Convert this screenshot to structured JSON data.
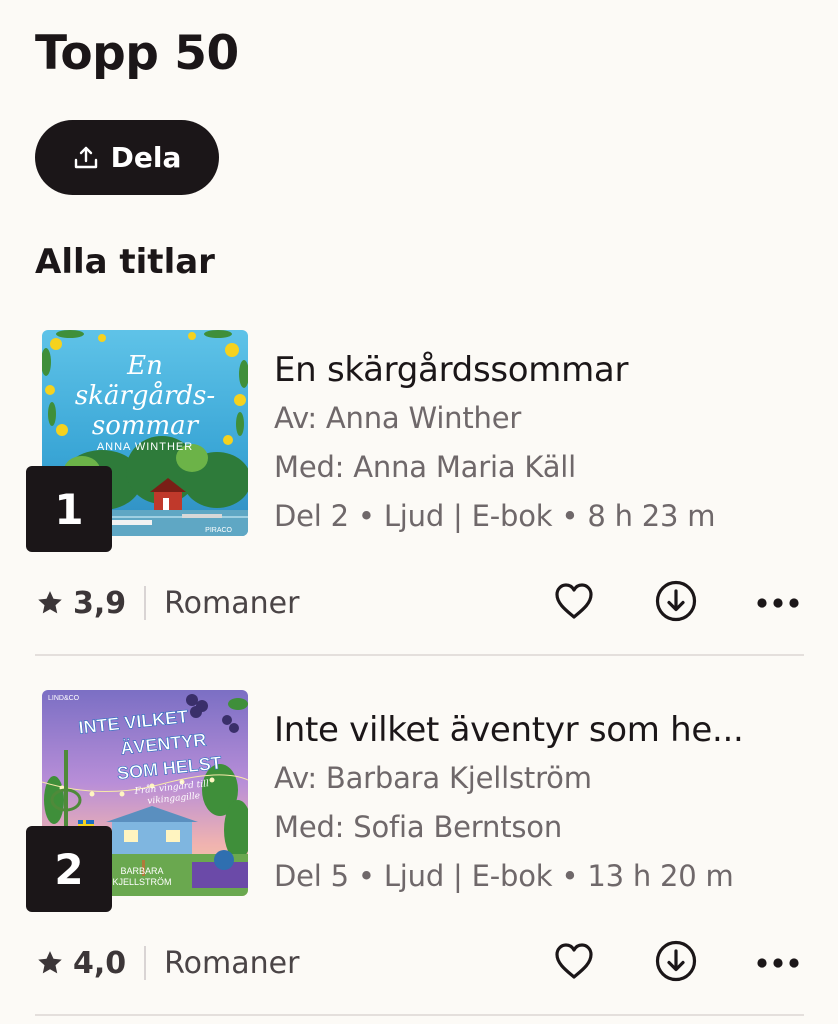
{
  "header": {
    "title": "Topp 50",
    "share_label": "Dela",
    "share_icon": "share-upload-icon"
  },
  "section": {
    "title": "Alla titlar"
  },
  "books": [
    {
      "rank": "1",
      "title": "En skärgårdssommar",
      "author": "Av: Anna Winther",
      "narrator": "Med: Anna Maria Käll",
      "details": "Del 2 • Ljud | E-bok • 8 h 23 m",
      "rating": "3,9",
      "genre": "Romaner",
      "cover": {
        "title_lines": [
          "En",
          "skärgårds-",
          "sommar"
        ],
        "author": "ANNA WINTHER",
        "publisher": "PIRACO"
      }
    },
    {
      "rank": "2",
      "title": "Inte vilket äventyr som he...",
      "author": "Av: Barbara Kjellström",
      "narrator": "Med: Sofia Berntson",
      "details": "Del 5 • Ljud | E-bok • 13 h 20 m",
      "rating": "4,0",
      "genre": "Romaner",
      "cover": {
        "title_lines": [
          "INTE VILKET",
          "ÄVENTYR",
          "SOM HELST"
        ],
        "subtitle_lines": [
          "Från vingård till",
          "vikingagille"
        ],
        "author_lines": [
          "BARBARA",
          "KJELLSTRÖM"
        ],
        "publisher": "LIND&CO"
      }
    }
  ],
  "icons": {
    "star": "star-icon",
    "heart": "heart-icon",
    "download": "download-circle-icon",
    "more": "more-dots-icon"
  },
  "colors": {
    "background": "#fcfaf6",
    "primary": "#1b1618",
    "secondary_text": "#6f686a"
  }
}
